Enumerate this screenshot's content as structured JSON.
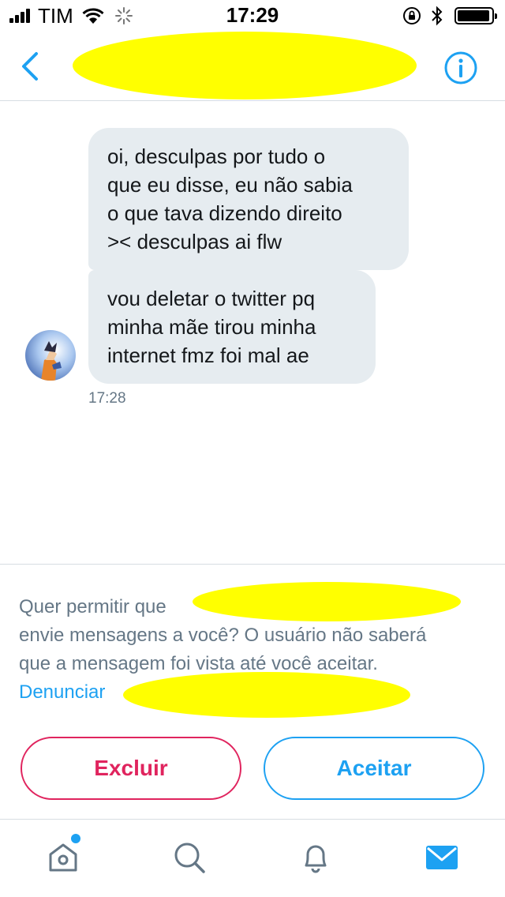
{
  "status_bar": {
    "carrier": "TIM",
    "time": "17:29",
    "battery_level": 0.95
  },
  "nav": {
    "back_icon": "chevron-left-icon",
    "info_icon": "info-icon",
    "accent_color": "#1da1f2"
  },
  "messages": [
    {
      "lines": [
        "oi, desculpas por tudo o",
        "que eu disse, eu não sabia",
        "o que tava dizendo direito",
        ">< desculpas ai flw"
      ]
    },
    {
      "lines": [
        "vou deletar o twitter pq",
        "minha mãe tirou minha",
        "internet fmz foi mal ae"
      ]
    }
  ],
  "message_time": "17:28",
  "request": {
    "line1": "Quer permitir que",
    "line2": "envie mensagens a você? O usuário não saberá",
    "line3": "que a mensagem foi vista até você aceitar.",
    "report_link": "Denunciar",
    "delete_button": "Excluir",
    "accept_button": "Aceitar",
    "delete_color": "#e0245e"
  },
  "tab_bar": {
    "tabs": [
      "home-icon",
      "search-icon",
      "bell-icon",
      "envelope-icon"
    ],
    "active": "envelope-icon"
  }
}
